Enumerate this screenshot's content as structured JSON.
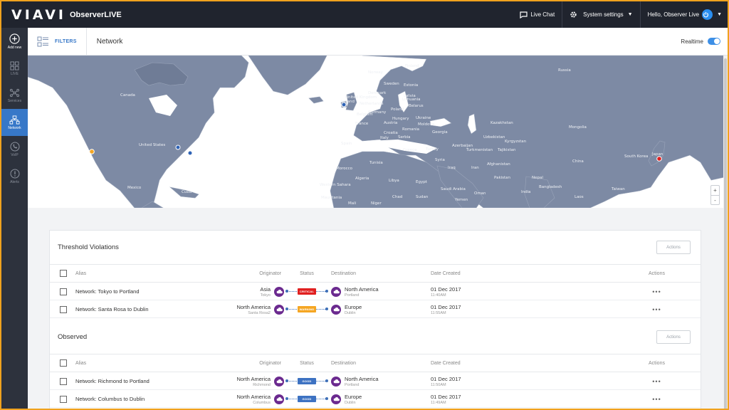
{
  "app": {
    "logo": "VIAVI",
    "name": "ObserverLIVE"
  },
  "topbar": {
    "live_chat": "Live Chat",
    "system_settings": "System settings",
    "user_greeting": "Hello, Observer Live"
  },
  "sidebar": {
    "items": [
      {
        "label": "Add new",
        "icon": "plus-circle-icon"
      },
      {
        "label": "LIVE",
        "icon": "grid-icon"
      },
      {
        "label": "Services",
        "icon": "nodes-icon"
      },
      {
        "label": "Network",
        "icon": "network-icon",
        "active": true
      },
      {
        "label": "VoIP",
        "icon": "phone-icon"
      },
      {
        "label": "Alerts",
        "icon": "alert-icon"
      }
    ]
  },
  "subbar": {
    "filters_label": "FILTERS",
    "page_title": "Network",
    "realtime_label": "Realtime",
    "realtime_on": true
  },
  "map": {
    "labels": [
      "Canada",
      "United States",
      "Mexico",
      "Cuba",
      "Finland",
      "Sweden",
      "Norway",
      "Denmark",
      "Russia",
      "Estonia",
      "Latvia",
      "Lithuania",
      "Belarus",
      "Poland",
      "Germany",
      "France",
      "Spain",
      "Austria",
      "Ukraine",
      "Romania",
      "Greece",
      "Turkey",
      "Tunisia",
      "Morocco",
      "Algeria",
      "Libya",
      "Egypt",
      "Western Sahara",
      "Mauritania",
      "Mali",
      "Niger",
      "Kazakhstan",
      "Kyrgyzstan",
      "Uzbekistan",
      "Turkmenistan",
      "Tajikistan",
      "Mongolia",
      "China",
      "Afghanistan",
      "Pakistan",
      "Iran",
      "Iraq",
      "Syria",
      "Saudi Arabia",
      "Oman",
      "India",
      "Nepal",
      "Bangladesh",
      "Laos",
      "Taiwan",
      "South Korea",
      "Japan",
      "Azerbaijan",
      "Georgia",
      "Moldova",
      "Ireland",
      "United Kingdom",
      "Netherlands",
      "Belgium",
      "Croatia",
      "Serbia",
      "Hungary",
      "Italy",
      "Chad",
      "Sudan",
      "Yemen"
    ],
    "zoom_in": "+",
    "zoom_out": "-"
  },
  "threshold": {
    "title": "Threshold Violations",
    "actions_button": "Actions",
    "headers": {
      "alias": "Alias",
      "originator": "Originator",
      "status": "Status",
      "destination": "Destination",
      "date": "Date Created",
      "actions": "Actions"
    },
    "rows": [
      {
        "alias": "Network: Tokyo to Portland",
        "orig": "Asia",
        "orig_sub": "Tokyo",
        "status": "CRITICAL",
        "status_color": "#e02020",
        "dest": "North America",
        "dest_sub": "Portland",
        "date": "01 Dec 2017",
        "time": "11:40AM",
        "more": "•••"
      },
      {
        "alias": "Network: Santa Rosa to Dublin",
        "orig": "North America",
        "orig_sub": "Santa Rosa2",
        "status": "WARNING",
        "status_color": "#f5a623",
        "dest": "Europe",
        "dest_sub": "Dublin",
        "date": "01 Dec 2017",
        "time": "11:55AM",
        "more": "•••"
      }
    ]
  },
  "observed": {
    "title": "Observed",
    "actions_button": "Actions",
    "headers": {
      "alias": "Alias",
      "originator": "Originator",
      "status": "Status",
      "destination": "Destination",
      "date": "Date Created",
      "actions": "Actions"
    },
    "rows": [
      {
        "alias": "Network: Richmond to Portland",
        "orig": "North America",
        "orig_sub": "Richmond",
        "status": "GOOD",
        "status_color": "#3d72c2",
        "dest": "North America",
        "dest_sub": "Portland",
        "date": "01 Dec 2017",
        "time": "11:50AM",
        "more": "•••"
      },
      {
        "alias": "Network: Columbus to Dublin",
        "orig": "North America",
        "orig_sub": "Columbus",
        "status": "GOOD",
        "status_color": "#3d72c2",
        "dest": "Europe",
        "dest_sub": "Dublin",
        "date": "01 Dec 2017",
        "time": "11:49AM",
        "more": "•••"
      }
    ]
  },
  "colors": {
    "accent": "#3778c8",
    "map_land": "#7d8aa4",
    "map_water": "#ffffff",
    "blob": "#6b2a8f"
  }
}
